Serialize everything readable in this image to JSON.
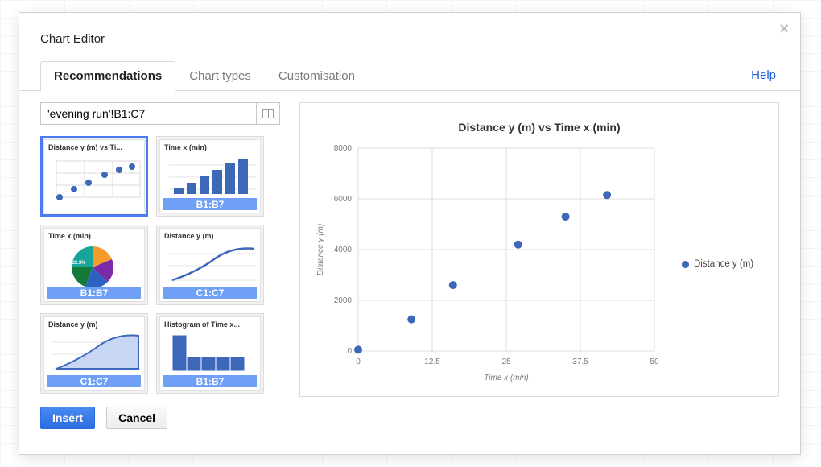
{
  "dialog": {
    "title": "Chart Editor",
    "help_label": "Help",
    "tabs": [
      {
        "label": "Recommendations",
        "selected": true
      },
      {
        "label": "Chart types",
        "selected": false
      },
      {
        "label": "Customisation",
        "selected": false
      }
    ]
  },
  "range": {
    "value": "'evening run'!B1:C7"
  },
  "thumbs": [
    {
      "title": "Distance y (m) vs Ti...",
      "type": "scatter",
      "strip": null,
      "selected": true
    },
    {
      "title": "Time x (min)",
      "type": "bar",
      "strip": "B1:B7",
      "selected": false
    },
    {
      "title": "Time x (min)",
      "type": "pie",
      "strip": "B1:B7",
      "selected": false,
      "pie_label": "32.3%"
    },
    {
      "title": "Distance y (m)",
      "type": "line",
      "strip": "C1:C7",
      "selected": false
    },
    {
      "title": "Distance y (m)",
      "type": "area",
      "strip": "C1:C7",
      "selected": false
    },
    {
      "title": "Histogram of Time x...",
      "type": "hist",
      "strip": "B1:B7",
      "selected": false
    }
  ],
  "buttons": {
    "insert": "Insert",
    "cancel": "Cancel"
  },
  "chart_data": {
    "type": "scatter",
    "title": "Distance y (m) vs Time x (min)",
    "xlabel": "Time x (min)",
    "ylabel": "Distance y (m)",
    "legend": [
      "Distance y (m)"
    ],
    "x_ticks": [
      0,
      12.5,
      25,
      37.5,
      50
    ],
    "y_ticks": [
      0,
      2000,
      4000,
      6000,
      8000
    ],
    "xlim": [
      0,
      50
    ],
    "ylim": [
      0,
      8000
    ],
    "series": [
      {
        "name": "Distance y (m)",
        "x": [
          0,
          9,
          16,
          27,
          35,
          42
        ],
        "y": [
          50,
          1250,
          2600,
          4200,
          5300,
          6150
        ]
      }
    ]
  }
}
